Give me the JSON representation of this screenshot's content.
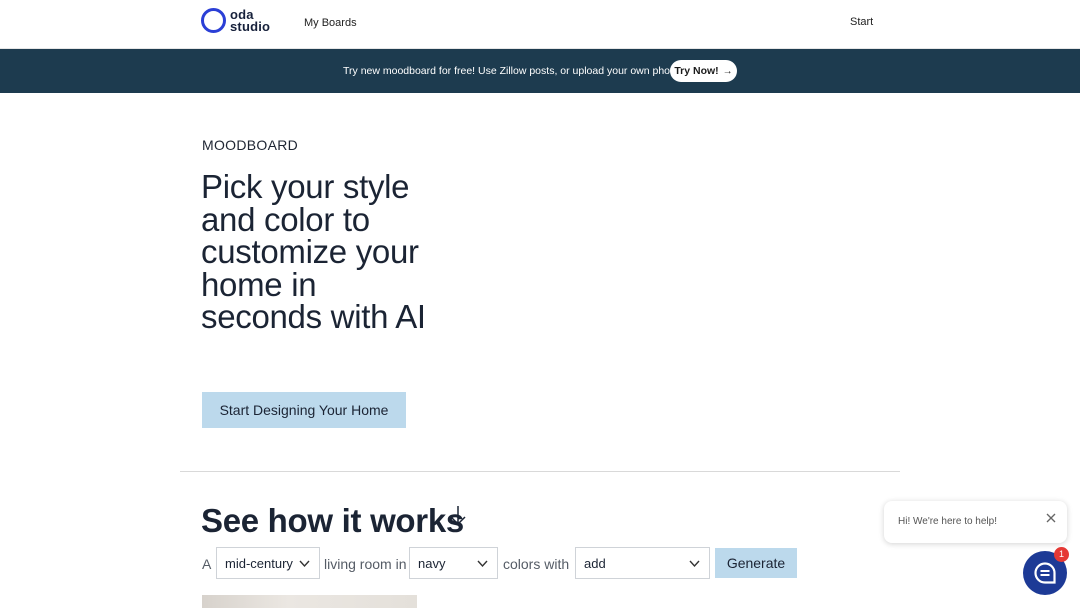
{
  "header": {
    "logo_text_line1": "oda",
    "logo_text_line2": "studio",
    "nav_boards": "My Boards",
    "nav_start": "Start"
  },
  "banner": {
    "text": "Try new moodboard for free! Use Zillow posts, or upload your own photos.",
    "button_label": "Try Now!",
    "button_arrow": "→"
  },
  "hero": {
    "eyebrow": "MOODBOARD",
    "headline": "Pick your style and color to customize your home in seconds with AI",
    "cta_label": "Start Designing Your Home"
  },
  "how_it_works": {
    "title": "See how it works",
    "sentence": {
      "word_a": "A",
      "style_select": "mid-century",
      "word_room": "living room in",
      "color_select": "navy",
      "word_colors": "colors with",
      "add_select": "add"
    },
    "generate_label": "Generate"
  },
  "chat": {
    "bubble_text": "Hi! We're here to help!",
    "badge_count": "1"
  },
  "colors": {
    "brand_blue": "#2b3fd6",
    "banner_bg": "#1d3b4f",
    "cta_bg": "#bcd9ec",
    "chat_launcher": "#1d3a96",
    "badge_red": "#e53935"
  }
}
